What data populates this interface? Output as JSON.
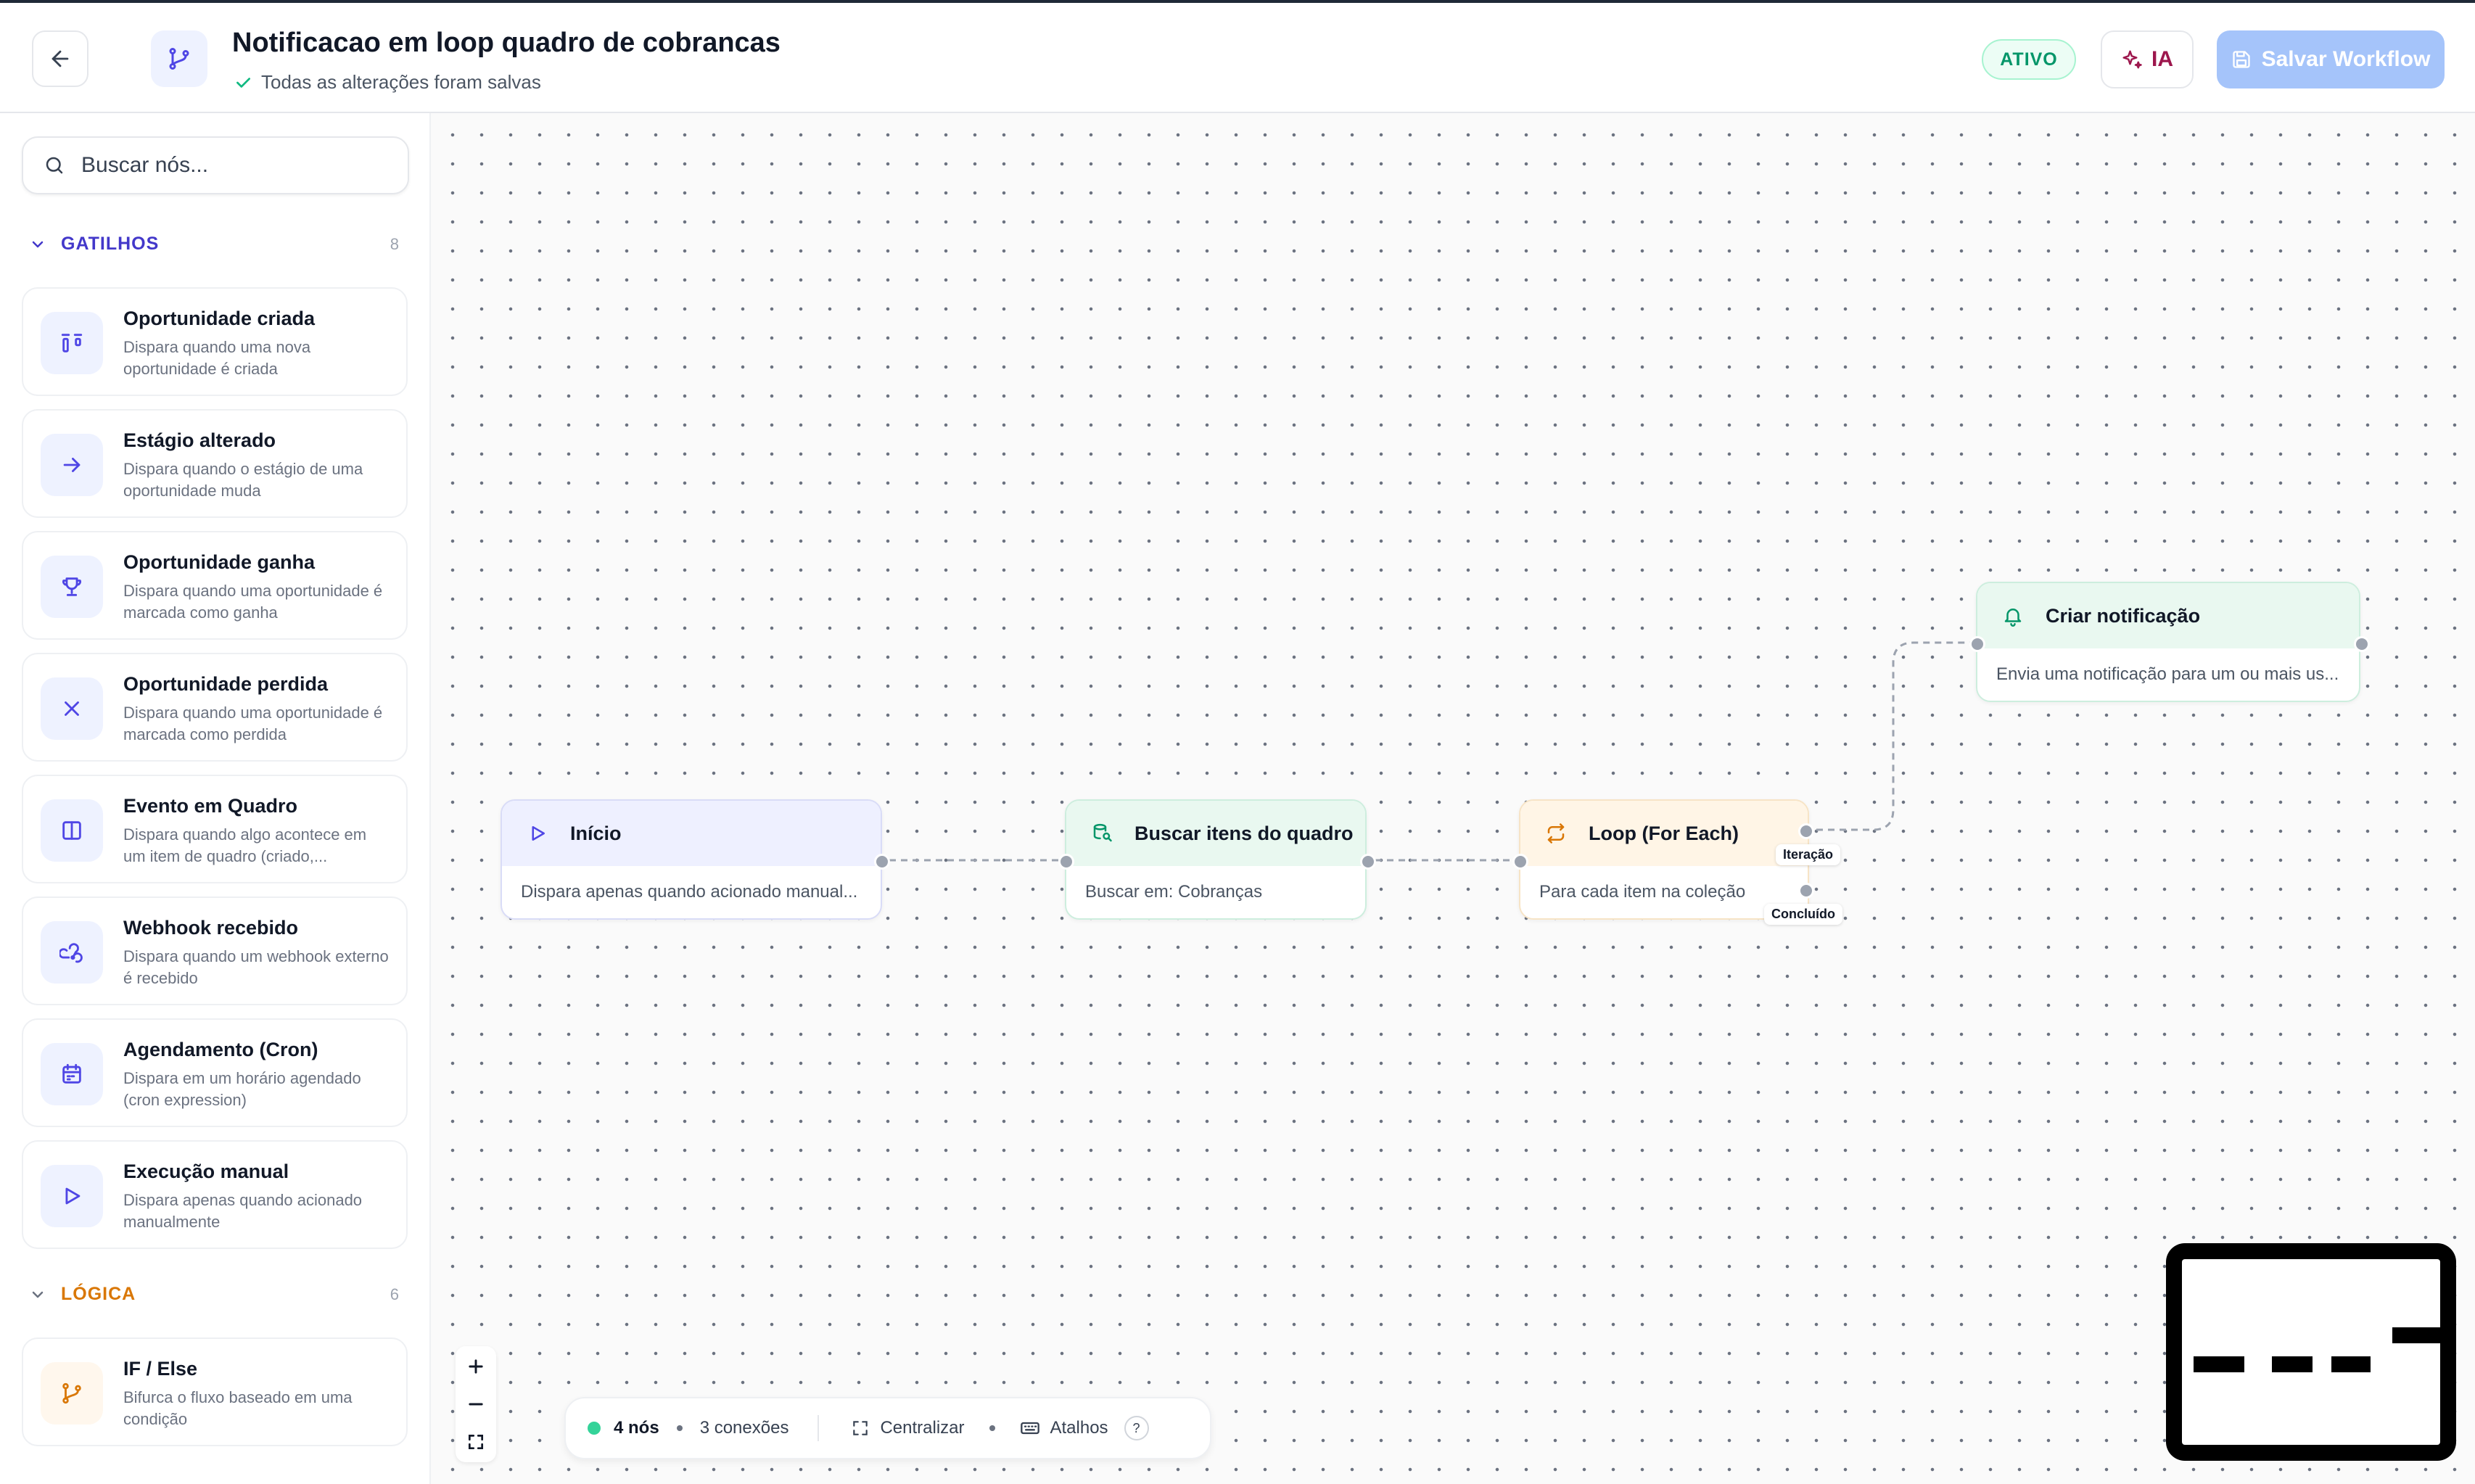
{
  "header": {
    "title": "Notificacao em loop quadro de cobrancas",
    "saved_status": "Todas as alterações foram salvas",
    "status_badge": "ATIVO",
    "ai_label": "IA",
    "save_label": "Salvar Workflow"
  },
  "sidebar": {
    "search_placeholder": "Buscar nós...",
    "sections": [
      {
        "title": "GATILHOS",
        "count": "8",
        "color": "#4338ca",
        "items": [
          {
            "name": "Oportunidade criada",
            "description": "Dispara quando uma nova oportunidade é criada",
            "icon": "kanban-icon"
          },
          {
            "name": "Estágio alterado",
            "description": "Dispara quando o estágio de uma oportunidade muda",
            "icon": "arrow-right-icon"
          },
          {
            "name": "Oportunidade ganha",
            "description": "Dispara quando uma oportunidade é marcada como ganha",
            "icon": "trophy-icon"
          },
          {
            "name": "Oportunidade perdida",
            "description": "Dispara quando uma oportunidade é marcada como perdida",
            "icon": "x-icon"
          },
          {
            "name": "Evento em Quadro",
            "description": "Dispara quando algo acontece em um item de quadro (criado,...",
            "icon": "board-icon"
          },
          {
            "name": "Webhook recebido",
            "description": "Dispara quando um webhook externo é recebido",
            "icon": "webhook-icon"
          },
          {
            "name": "Agendamento (Cron)",
            "description": "Dispara em um horário agendado (cron expression)",
            "icon": "calendar-icon"
          },
          {
            "name": "Execução manual",
            "description": "Dispara apenas quando acionado manualmente",
            "icon": "play-icon"
          }
        ]
      },
      {
        "title": "LÓGICA",
        "count": "6",
        "color": "#d97706",
        "items": [
          {
            "name": "IF / Else",
            "description": "Bifurca o fluxo baseado em uma condição",
            "icon": "branch-icon"
          }
        ]
      }
    ]
  },
  "canvas": {
    "nodes": [
      {
        "title": "Início",
        "description": "Dispara apenas quando acionado manual...",
        "icon": "play-icon"
      },
      {
        "title": "Buscar itens do quadro",
        "description": "Buscar em: Cobranças",
        "icon": "database-search-icon"
      },
      {
        "title": "Loop (For Each)",
        "description": "Para cada item na coleção",
        "icon": "repeat-icon"
      },
      {
        "title": "Criar notificação",
        "description": "Envia uma notificação para um ou mais us...",
        "icon": "bell-icon"
      }
    ],
    "port_labels": {
      "iteration": "Iteração",
      "done": "Concluído"
    }
  },
  "statusbar": {
    "nodes_count": "4 nós",
    "connections_count": "3 conexões",
    "center_label": "Centralizar",
    "shortcuts_label": "Atalhos",
    "help_label": "?"
  },
  "colors": {
    "accent_indigo": "#4338ca",
    "logic_orange": "#d97706",
    "active_green": "#059669",
    "save_button": "#a5c4fa"
  }
}
